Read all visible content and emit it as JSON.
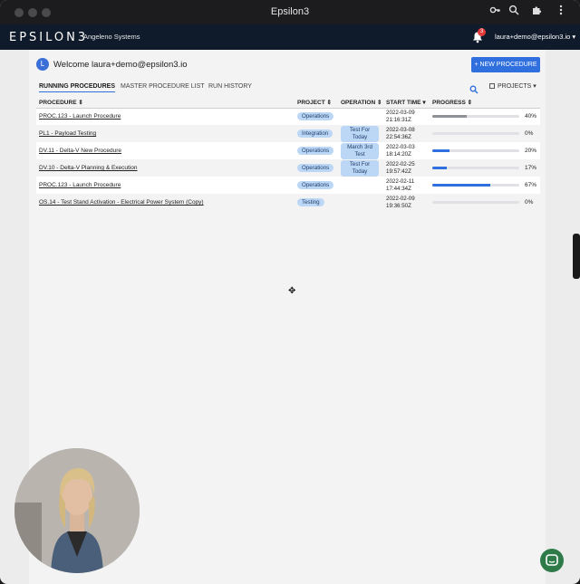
{
  "window": {
    "title": "Epsilon3"
  },
  "appbar": {
    "logo": "EPSILON3",
    "org": "Angeleno Systems",
    "notifications_count": "3",
    "user": "laura+demo@epsilon3.io ▾"
  },
  "header": {
    "avatar_letter": "L",
    "welcome": "Welcome laura+demo@epsilon3.io",
    "new_procedure_label": "+ NEW PROCEDURE"
  },
  "tabs": [
    {
      "label": "RUNNING PROCEDURES",
      "active": true
    },
    {
      "label": "MASTER PROCEDURE LIST",
      "active": false
    },
    {
      "label": "RUN HISTORY",
      "active": false
    }
  ],
  "filter": {
    "projects_label": "PROJECTS ▾"
  },
  "table": {
    "headers": {
      "procedure": "PROCEDURE ⇕",
      "project": "PROJECT ⇕",
      "operation": "OPERATION ⇕",
      "start_time": "START TIME ▾",
      "progress": "PROGRESS ⇕"
    },
    "rows": [
      {
        "procedure": "PROC.123 - Launch Procedure",
        "project": "Operations",
        "operation": "",
        "date": "2022-03-09",
        "time": "21:16:31Z",
        "progress_pct": "40%",
        "progress": 0.4,
        "fill_color": "#8e9196"
      },
      {
        "procedure": "PL1 - Payload Testing",
        "project": "Integration",
        "operation": "Test For Today",
        "date": "2022-03-08",
        "time": "22:54:36Z",
        "progress_pct": "0%",
        "progress": 0.0,
        "fill_color": "#8e9196"
      },
      {
        "procedure": "DV.11 - Delta-V New Procedure",
        "project": "Operations",
        "operation": "March 3rd Test",
        "date": "2022-03-03",
        "time": "18:14:20Z",
        "progress_pct": "20%",
        "progress": 0.2,
        "fill_color": "#2f6fde"
      },
      {
        "procedure": "DV.10 - Delta-V Planning & Execution",
        "project": "Operations",
        "operation": "Test For Today",
        "date": "2022-02-25",
        "time": "19:57:42Z",
        "progress_pct": "17%",
        "progress": 0.17,
        "fill_color": "#2f6fde"
      },
      {
        "procedure": "PROC.123 - Launch Procedure",
        "project": "Operations",
        "operation": "",
        "date": "2022-02-11",
        "time": "17:44:34Z",
        "progress_pct": "67%",
        "progress": 0.67,
        "fill_color": "#2f6fde"
      },
      {
        "procedure": "OS.14 - Test Stand Activation - Electrical Power System (Copy)",
        "project": "Testing",
        "operation": "",
        "date": "2022-02-09",
        "time": "19:36:50Z",
        "progress_pct": "0%",
        "progress": 0.0,
        "fill_color": "#8e9196"
      }
    ]
  }
}
